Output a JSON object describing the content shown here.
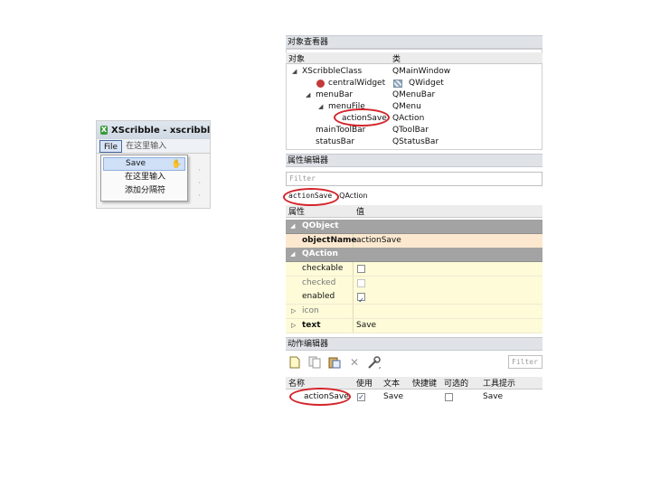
{
  "designer": {
    "window_title": "XScribble - xscribble.ui*",
    "menubar": {
      "file": "File",
      "placeholder": "在这里输入"
    },
    "menu_items": [
      {
        "label": "Save"
      },
      {
        "label": "在这里输入"
      },
      {
        "label": "添加分隔符"
      }
    ]
  },
  "object_inspector": {
    "title": "对象查看器",
    "columns": {
      "object": "对象",
      "class": "类"
    },
    "rows": [
      {
        "object": "XScribbleClass",
        "class": "QMainWindow"
      },
      {
        "object": "centralWidget",
        "class": "QWidget"
      },
      {
        "object": "menuBar",
        "class": "QMenuBar"
      },
      {
        "object": "menuFile",
        "class": "QMenu"
      },
      {
        "object": "actionSave",
        "class": "QAction"
      },
      {
        "object": "mainToolBar",
        "class": "QToolBar"
      },
      {
        "object": "statusBar",
        "class": "QStatusBar"
      }
    ]
  },
  "property_editor": {
    "title": "属性编辑器",
    "filter_placeholder": "Filter",
    "current_object": "actionSave",
    "current_class": "QAction",
    "columns": {
      "property": "属性",
      "value": "值"
    },
    "groups": {
      "qobject": "QObject",
      "qaction": "QAction"
    },
    "object_name_label": "objectName",
    "object_name_value": "actionSave",
    "checkable_label": "checkable",
    "checked_label": "checked",
    "enabled_label": "enabled",
    "icon_label": "icon",
    "text_label": "text",
    "text_value": "Save",
    "checkable": false,
    "checked": false,
    "enabled": true
  },
  "action_editor": {
    "title": "动作编辑器",
    "filter_placeholder": "Filter",
    "columns": [
      "名称",
      "使用",
      "文本",
      "快捷键",
      "可选的",
      "工具提示"
    ],
    "row": {
      "name": "actionSave",
      "used": true,
      "text": "Save",
      "shortcut": "",
      "checkable": false,
      "tooltip": "Save"
    }
  },
  "colors": {
    "highlight_circle": "#d4242b",
    "group_header": "#a3a3a3",
    "qobject_row": "#fbe8cf",
    "qaction_row": "#fdfbd8"
  }
}
